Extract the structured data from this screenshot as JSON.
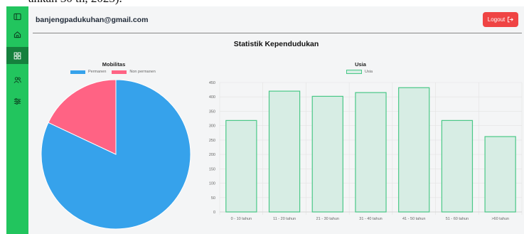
{
  "page_top_text": "ahkan 30 th, 2023).",
  "user": {
    "email": "banjengpadukuhan@gmail.com"
  },
  "header": {
    "logout_label": "Logout"
  },
  "page": {
    "title": "Statistik Kependudukan"
  },
  "sidebar": {
    "items": [
      {
        "icon": "sidebar-toggle-icon",
        "active": false
      },
      {
        "icon": "home-icon",
        "active": false
      },
      {
        "icon": "dashboard-grid-icon",
        "active": true
      },
      {
        "icon": "users-icon",
        "active": false
      },
      {
        "icon": "list-settings-icon",
        "active": false
      }
    ]
  },
  "colors": {
    "sidebar": "#22c55e",
    "sidebar_active": "#15803d",
    "logout": "#ef4444",
    "pie_permanen": "#36a2eb",
    "pie_non_permanen": "#ff6384",
    "bar_fill": "#d7ede4",
    "bar_stroke": "#4ac887"
  },
  "chart_data": [
    {
      "type": "pie",
      "title": "Mobilitas",
      "legend_position": "top",
      "categories": [
        "Permanen",
        "Non permanen"
      ],
      "values": [
        82,
        18
      ]
    },
    {
      "type": "bar",
      "title": "Usia",
      "legend_position": "top",
      "categories": [
        "0 - 10 tahun",
        "11 - 20 tahun",
        "21 - 30 tahun",
        "31 - 40 tahun",
        "41 - 50 tahun",
        "51 - 60 tahun",
        ">60 tahun"
      ],
      "series": [
        {
          "name": "Usia",
          "values": [
            318,
            420,
            402,
            415,
            432,
            318,
            262
          ]
        }
      ],
      "ylim": [
        0,
        450
      ],
      "yticks": [
        0,
        50,
        100,
        150,
        200,
        250,
        300,
        350,
        400,
        450
      ],
      "grid": true
    }
  ]
}
